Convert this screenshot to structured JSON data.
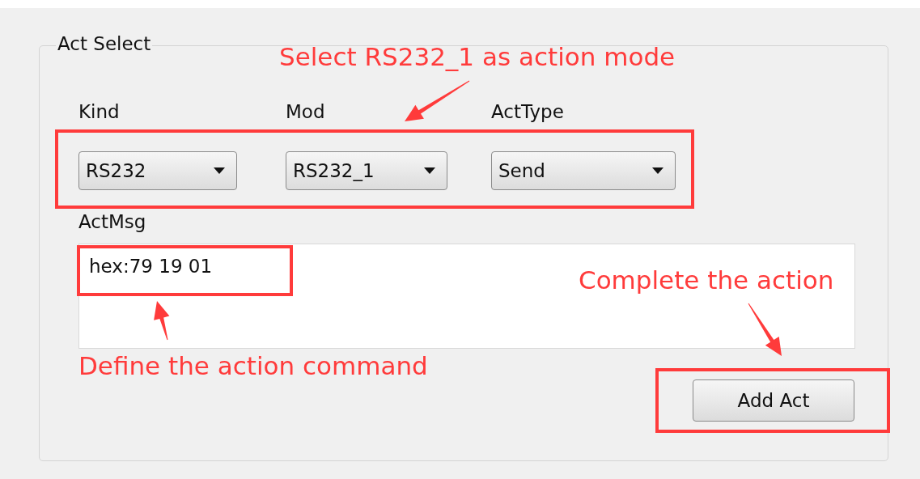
{
  "group": {
    "title": "Act Select"
  },
  "selectors": [
    {
      "label": "Kind",
      "value": "RS232"
    },
    {
      "label": "Mod",
      "value": "RS232_1"
    },
    {
      "label": "ActType",
      "value": "Send"
    }
  ],
  "message": {
    "label": "ActMsg",
    "value": "hex:79 19 01"
  },
  "button": {
    "label": "Add Act"
  },
  "annotations": [
    {
      "text": "Select RS232_1 as action mode"
    },
    {
      "text": "Complete the action"
    },
    {
      "text": "Define the action command"
    }
  ]
}
